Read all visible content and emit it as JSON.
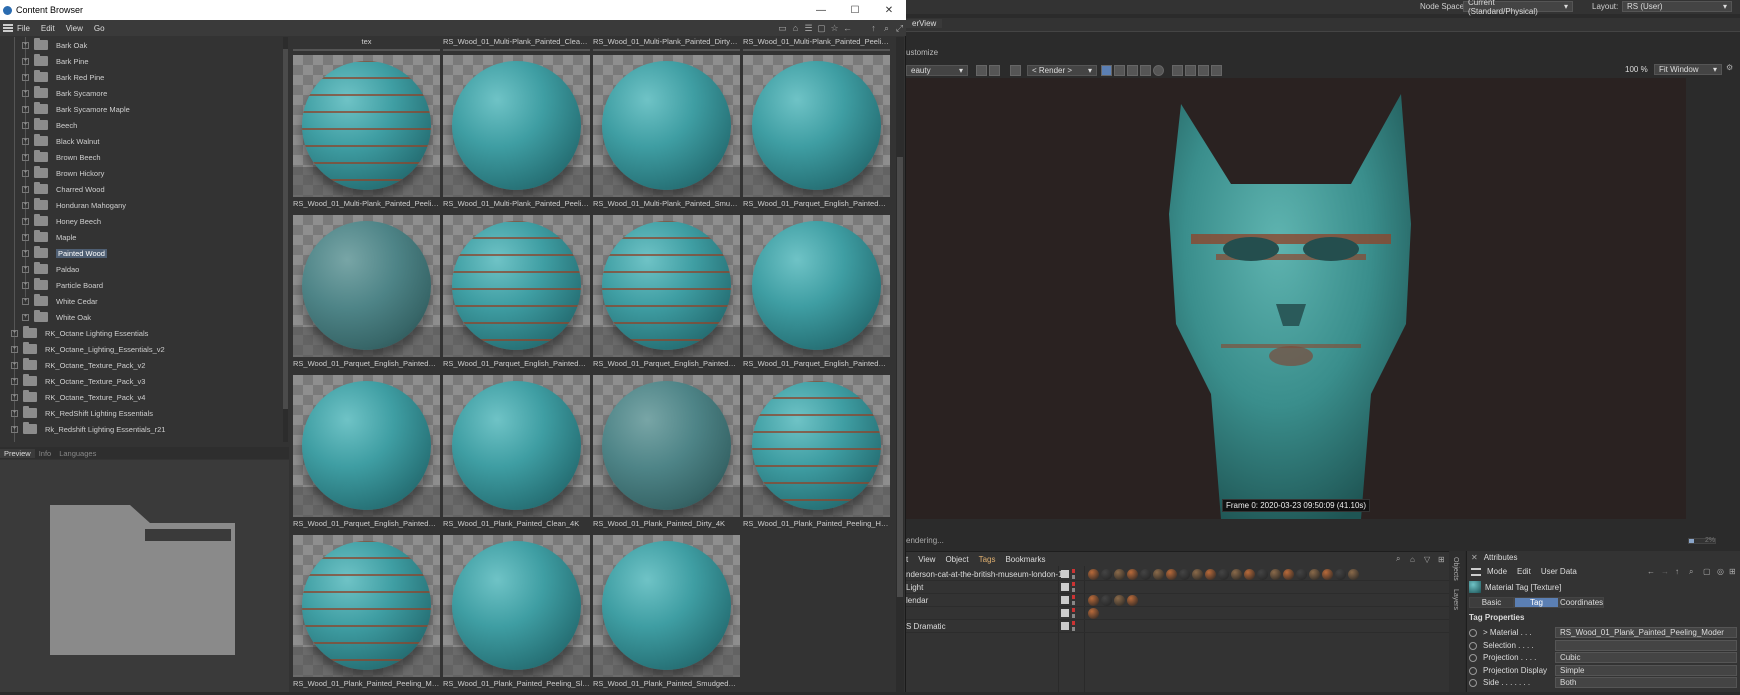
{
  "content_browser": {
    "title": "Content Browser",
    "menu": [
      "File",
      "Edit",
      "View",
      "Go"
    ],
    "window_controls": [
      "—",
      "☐",
      "✕"
    ],
    "tree": {
      "subfolders": [
        "Bark Oak",
        "Bark Pine",
        "Bark Red Pine",
        "Bark Sycamore",
        "Bark Sycamore Maple",
        "Beech",
        "Black Walnut",
        "Brown Beech",
        "Brown Hickory",
        "Charred Wood",
        "Honduran Mahogany",
        "Honey Beech",
        "Maple",
        "Painted Wood",
        "Paldao",
        "Particle Board",
        "White Cedar",
        "White Oak"
      ],
      "selected": "Painted Wood",
      "root_folders": [
        "RK_Octane Lighting Essentials",
        "RK_Octane_Lighting_Essentials_v2",
        "RK_Octane_Texture_Pack_v2",
        "RK_Octane_Texture_Pack_v3",
        "RK_Octane_Texture_Pack_v4",
        "RK_RedShift Lighting Essentials",
        "Rk_Redshift Lighting Essentials_r21"
      ]
    },
    "preview_tabs": [
      "Preview",
      "Info",
      "Languages"
    ],
    "top_row_labels": [
      "tex",
      "RS_Wood_01_Multi-Plank_Painted_Clean_4K",
      "RS_Wood_01_Multi-Plank_Painted_Dirty_4K",
      "RS_Wood_01_Multi-Plank_Painted_Peeling_..."
    ],
    "materials": [
      {
        "label": "RS_Wood_01_Multi-Plank_Painted_Peeling_...",
        "style": "rust"
      },
      {
        "label": "RS_Wood_01_Multi-Plank_Painted_Peeling_...",
        "style": "clean"
      },
      {
        "label": "RS_Wood_01_Multi-Plank_Painted_Smudg...",
        "style": "clean"
      },
      {
        "label": "RS_Wood_01_Parquet_English_Painted_Cle...",
        "style": "clean"
      },
      {
        "label": "RS_Wood_01_Parquet_English_Painted_Dirt...",
        "style": "dirty"
      },
      {
        "label": "RS_Wood_01_Parquet_English_Painted_Pee...",
        "style": "rust"
      },
      {
        "label": "RS_Wood_01_Parquet_English_Painted_Pee...",
        "style": "rust"
      },
      {
        "label": "RS_Wood_01_Parquet_English_Painted_Pee...",
        "style": "clean"
      },
      {
        "label": "RS_Wood_01_Parquet_English_Painted_Sm...",
        "style": "clean"
      },
      {
        "label": "RS_Wood_01_Plank_Painted_Clean_4K",
        "style": "clean"
      },
      {
        "label": "RS_Wood_01_Plank_Painted_Dirty_4K",
        "style": "dirty"
      },
      {
        "label": "RS_Wood_01_Plank_Painted_Peeling_Heav...",
        "style": "rust"
      },
      {
        "label": "RS_Wood_01_Plank_Painted_Peeling_Mode...",
        "style": "rust"
      },
      {
        "label": "RS_Wood_01_Plank_Painted_Peeling_Slight...",
        "style": "clean"
      },
      {
        "label": "RS_Wood_01_Plank_Painted_Smudged_4K",
        "style": "clean"
      }
    ]
  },
  "top_bar": {
    "node_space_label": "Node Space:",
    "node_space_value": "Current (Standard/Physical)",
    "layout_label": "Layout:",
    "layout_value": "RS (User)"
  },
  "render_view": {
    "tab": "erView",
    "customize": "ustomize",
    "aov": "eauty",
    "camera": "< Render >",
    "zoom": "100 %",
    "fit": "Fit Window",
    "frame_info": "Frame  0:  2020-03-23  09:50:09  (41.10s)",
    "status": "endering...",
    "progress_fraction": 0.2,
    "progress_text": "2%"
  },
  "object_manager": {
    "menu": [
      "t",
      "View",
      "Object",
      "Tags",
      "Bookmarks"
    ],
    "rows": [
      {
        "name": "nderson-cat-at-the-british-museum-london-1",
        "tags": 21
      },
      {
        "name": "Light",
        "tags": 0
      },
      {
        "name": "lendar",
        "tags": 4
      },
      {
        "name": "",
        "tags": 1
      },
      {
        "name": "S Dramatic",
        "tags": 0
      }
    ]
  },
  "side_tabs": [
    "Objects",
    "Layers"
  ],
  "attributes": {
    "title": "Attributes",
    "menu": [
      "Mode",
      "Edit",
      "User Data"
    ],
    "material_tag": "Material Tag [Texture]",
    "tabs": [
      "Basic",
      "Tag",
      "Coordinates"
    ],
    "active_tab": "Tag",
    "section": "Tag Properties",
    "props": [
      {
        "label": "> Material . . .",
        "value": "RS_Wood_01_Plank_Painted_Peeling_Moder"
      },
      {
        "label": "Selection . . . .",
        "value": ""
      },
      {
        "label": "Projection . . . .",
        "value": "Cubic"
      },
      {
        "label": "Projection Display",
        "value": "Simple"
      },
      {
        "label": "Side . . . . . . .",
        "value": "Both"
      }
    ]
  },
  "colors": {
    "accent": "#5b7fb3",
    "teal": "#3f9ea3",
    "rust": "#8c462d"
  }
}
